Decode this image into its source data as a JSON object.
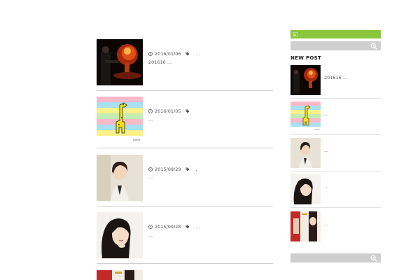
{
  "posts": [
    {
      "date": "2016/01/06",
      "tags": ". .",
      "excerpt": "201616  ..."
    },
    {
      "date": "2016/01/05",
      "tags": "",
      "excerpt": "..."
    },
    {
      "date": "2015/09/29",
      "tags": ",",
      "excerpt": "..."
    },
    {
      "date": "2015/09/28",
      "tags": ". .",
      "excerpt": "..."
    }
  ],
  "sidebar": {
    "new_post_title": "NEW POST",
    "items": [
      {
        "text": "201616  ..."
      },
      {
        "text": "..."
      },
      {
        "text": "..."
      },
      {
        "text": "..."
      },
      {
        "text": "..."
      }
    ]
  },
  "icons": [
    "clock-icon",
    "tag-icon",
    "rss-icon",
    "search-icon"
  ],
  "colors": {
    "accent_green": "#8cc63f",
    "search_bar": "#cfcfcf",
    "divider": "#cfcfcf"
  }
}
